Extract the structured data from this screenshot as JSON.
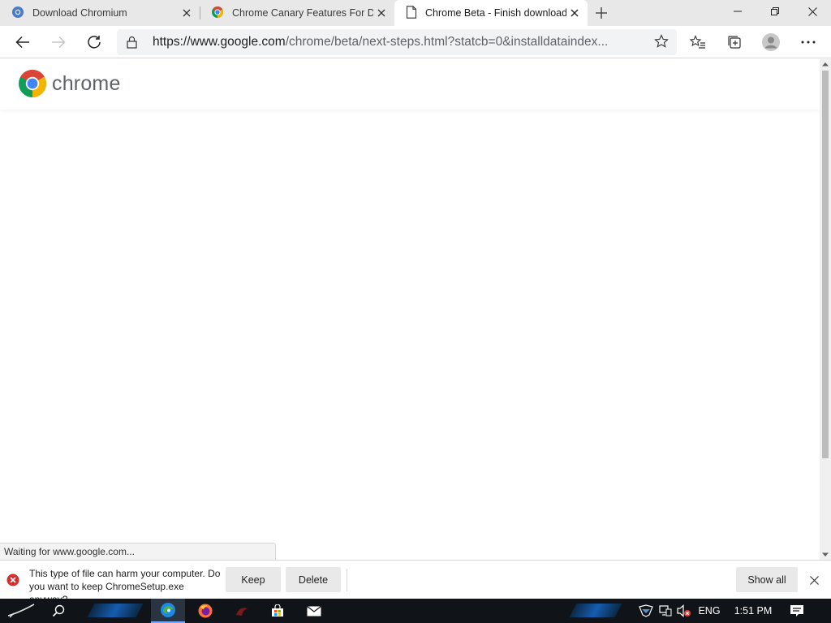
{
  "tabs": [
    {
      "title": "Download Chromium",
      "icon": "chromium-favicon",
      "active": false
    },
    {
      "title": "Chrome Canary Features For De",
      "icon": "chrome-favicon",
      "active": false
    },
    {
      "title": "Chrome Beta - Finish downloadi",
      "icon": "page-favicon",
      "active": true
    }
  ],
  "toolbar": {
    "url_host": "https://www.google.com",
    "url_path": "/chrome/beta/next-steps.html?statcb=0&installdataindex..."
  },
  "page": {
    "brand_wordmark": "chrome"
  },
  "status_text": "Waiting for www.google.com...",
  "download": {
    "message": "This type of file can harm your computer. Do you want to keep ChromeSetup.exe anyway?",
    "keep_label": "Keep",
    "delete_label": "Delete",
    "show_all_label": "Show all"
  },
  "taskbar": {
    "language": "ENG",
    "time": "1:51 PM"
  },
  "colors": {
    "tabstrip_bg": "#e8e8e8",
    "omnibox_bg": "#f1f3f4",
    "warning_red": "#d32f2f",
    "taskbar_bg": "#101418",
    "accent_blue": "#1565c0"
  }
}
